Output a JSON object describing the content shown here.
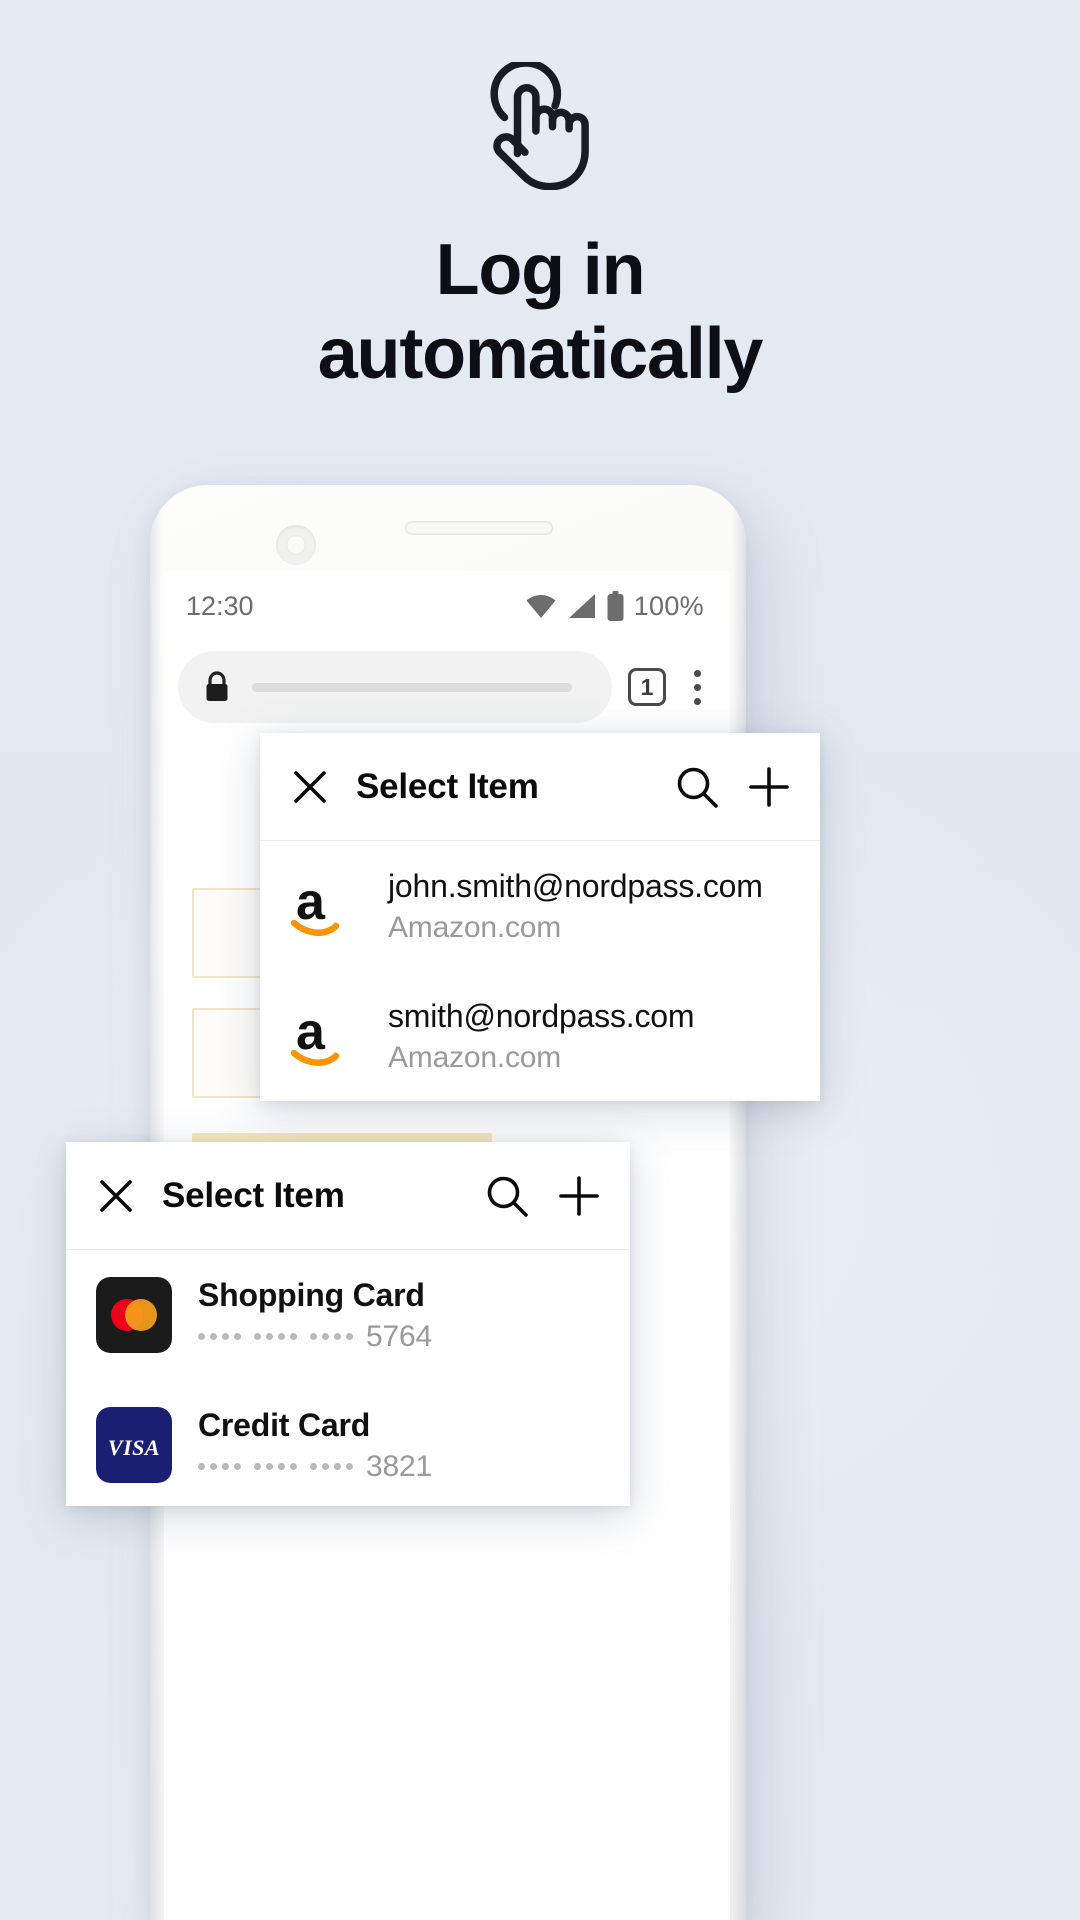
{
  "theme": {
    "background": "#e4eaf2",
    "heading_color": "#0d0f14",
    "amazon_orange": "#f79400",
    "mastercard_red": "#eb001b",
    "mastercard_orange": "#f79e1b",
    "visa_blue": "#1a1f71",
    "muted_text": "#9a9a9a"
  },
  "hero": {
    "icon": "tap-hand-icon",
    "title_line1": "Log in",
    "title_line2": "automatically"
  },
  "phone": {
    "status_bar": {
      "time": "12:30",
      "wifi_icon": "wifi-icon",
      "signal_icon": "cellular-signal-icon",
      "battery_icon": "battery-full-icon",
      "battery_percent": "100%"
    },
    "browser": {
      "lock_icon": "lock-icon",
      "url_value": "",
      "url_placeholder": "",
      "tab_count": "1",
      "menu_icon": "kebab-menu-icon"
    }
  },
  "popup_amazon": {
    "close_icon": "close-icon",
    "title": "Select Item",
    "search_icon": "search-icon",
    "add_icon": "plus-icon",
    "items": [
      {
        "logo": "amazon-logo-icon",
        "title": "john.smith@nordpass.com",
        "subtitle": "Amazon.com"
      },
      {
        "logo": "amazon-logo-icon",
        "title": "smith@nordpass.com",
        "subtitle": "Amazon.com"
      }
    ]
  },
  "popup_cards": {
    "close_icon": "close-icon",
    "title": "Select Item",
    "search_icon": "search-icon",
    "add_icon": "plus-icon",
    "items": [
      {
        "logo": "mastercard-logo-icon",
        "title": "Shopping Card",
        "masked": "•••• •••• ••••",
        "last4": "5764"
      },
      {
        "logo": "visa-logo-icon",
        "title": "Credit Card",
        "masked": "•••• •••• ••••",
        "last4": "3821"
      }
    ]
  }
}
